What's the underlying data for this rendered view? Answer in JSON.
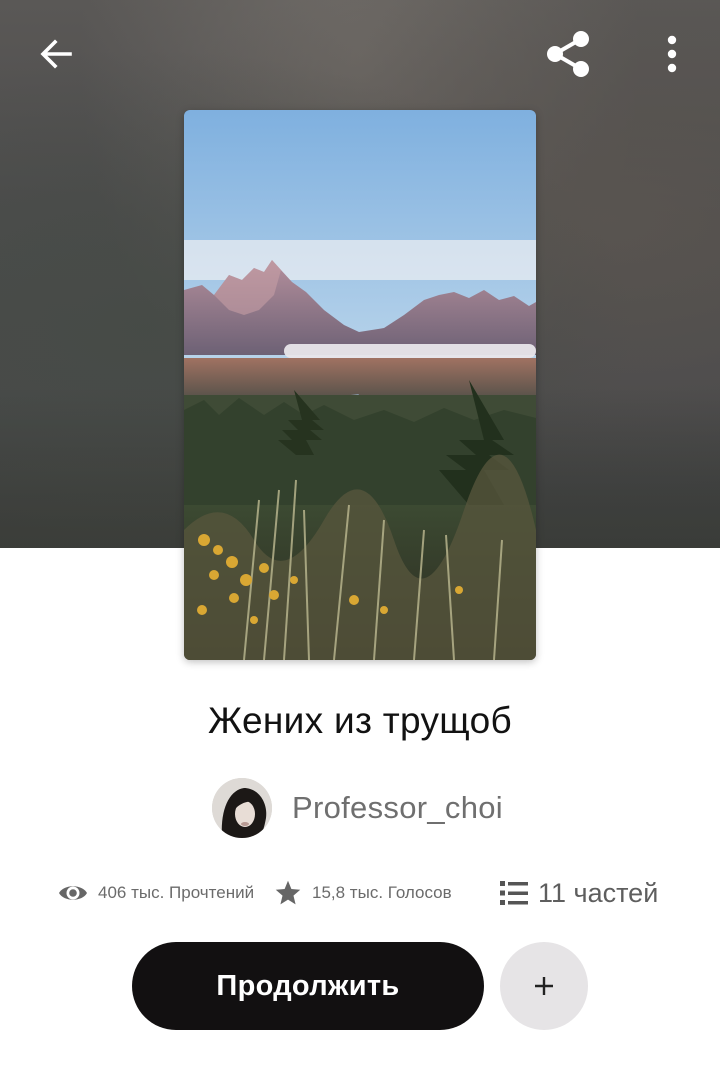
{
  "header": {
    "back_icon": "arrow-left-icon",
    "share_icon": "share-icon",
    "more_icon": "more-vertical-icon"
  },
  "story": {
    "title": "Жених из трущоб",
    "author": "Professor_choi",
    "cover_description_icon": "mountain-landscape-cover"
  },
  "stats": {
    "reads": "406 тыс. Прочтений",
    "votes": "15,8 тыс. Голосов",
    "parts": "11 частей",
    "reads_icon": "eye-icon",
    "votes_icon": "star-icon",
    "parts_icon": "list-icon"
  },
  "actions": {
    "continue_label": "Продолжить",
    "add_label": "+"
  },
  "colors": {
    "primary_button": "#121011",
    "secondary_button": "#e6e4e6",
    "muted_text": "#6b6b6b"
  }
}
